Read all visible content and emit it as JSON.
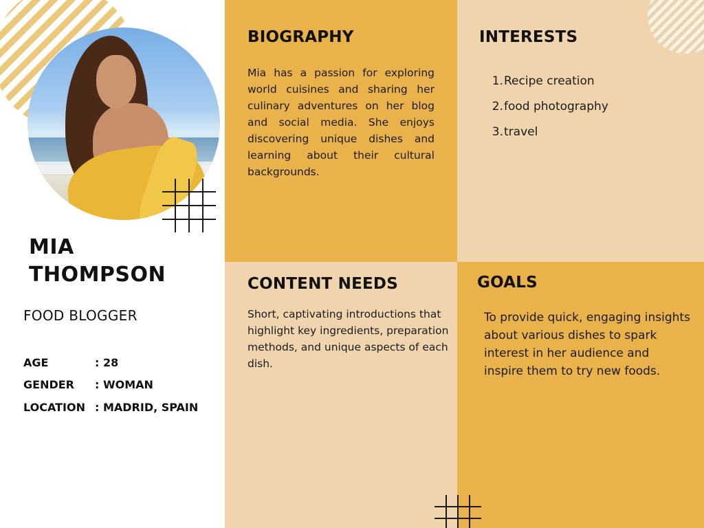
{
  "profile": {
    "name_line1": "MIA",
    "name_line2": "THOMPSON",
    "role": "FOOD BLOGGER",
    "details": [
      {
        "label": "AGE",
        "value": ": 28"
      },
      {
        "label": "GENDER",
        "value": ": WOMAN"
      },
      {
        "label": "LOCATION",
        "value": ": MADRID, SPAIN"
      }
    ]
  },
  "biography": {
    "title": "BIOGRAPHY",
    "text": "Mia has a passion for exploring world cuisines and sharing her culinary adventures on her blog and social media. She enjoys discovering unique dishes and learning about their cultural backgrounds."
  },
  "interests": {
    "title": "INTERESTS",
    "items": [
      {
        "num": "1.",
        "text": "Recipe creation"
      },
      {
        "num": "2.",
        "text": "food photography"
      },
      {
        "num": "3.",
        "text": "travel"
      }
    ]
  },
  "content_needs": {
    "title": "CONTENT NEEDS",
    "text": "Short, captivating introductions that highlight key ingredients, preparation methods, and unique aspects of each dish."
  },
  "goals": {
    "title": "GOALS",
    "text": "To provide quick, engaging insights about various dishes to spark interest in her audience and inspire them to try new foods."
  },
  "colors": {
    "mustard": "#e9b24a",
    "beige": "#efd4ae",
    "stripe": "#ecc97a",
    "text": "#111111"
  }
}
